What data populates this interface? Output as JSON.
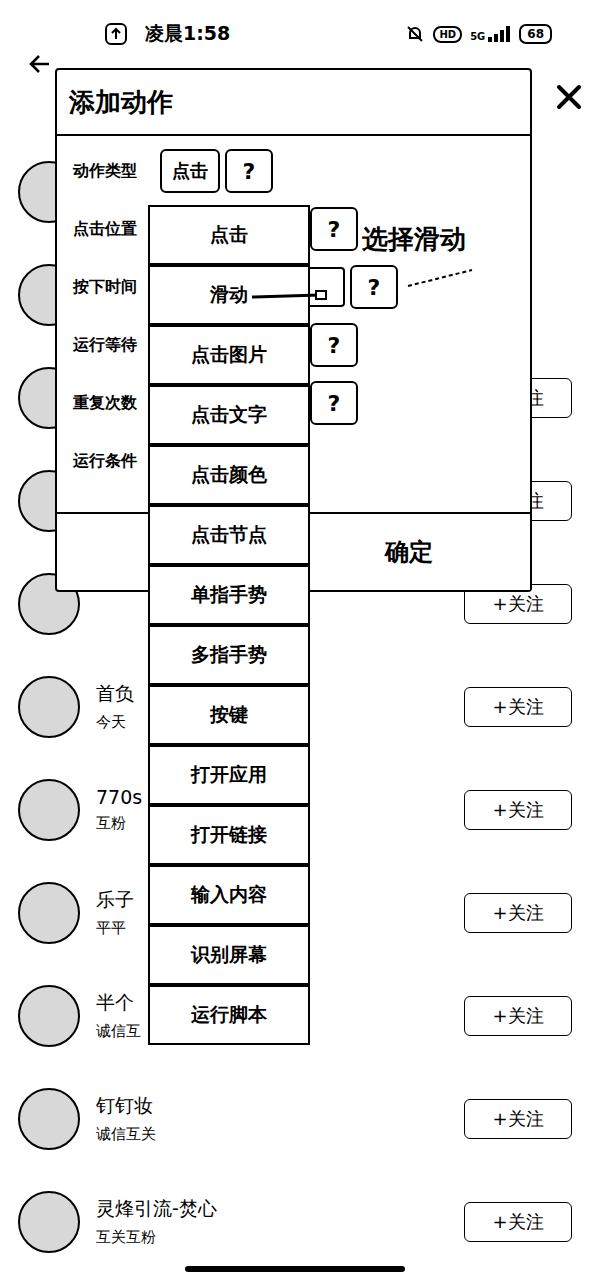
{
  "statusBar": {
    "time": "凌晨1:58",
    "hd": "HD",
    "network": "5G",
    "battery": "68"
  },
  "list": [
    {
      "name": "",
      "sub": "",
      "follow": ""
    },
    {
      "name": "",
      "sub": "",
      "follow": ""
    },
    {
      "name": "",
      "sub": "",
      "follow": "+关注"
    },
    {
      "name": "",
      "sub": "",
      "follow": "+关注"
    },
    {
      "name": "",
      "sub": "",
      "follow": "+关注"
    },
    {
      "name": "首负",
      "sub": "今天",
      "follow": "+关注"
    },
    {
      "name": "770s",
      "sub": "互粉",
      "follow": "+关注"
    },
    {
      "name": "乐子",
      "sub": "平平",
      "follow": "+关注"
    },
    {
      "name": "半个",
      "sub": "诚信互",
      "follow": "+关注"
    },
    {
      "name": "钉钉妆",
      "sub": "诚信互关",
      "follow": "+关注"
    },
    {
      "name": "灵烽引流-焚心",
      "sub": "互关互粉",
      "follow": "+关注"
    }
  ],
  "dialog": {
    "title": "添加动作",
    "fields": [
      {
        "label": "动作类型",
        "kind": "select",
        "value": "点击",
        "help": "?"
      },
      {
        "label": "点击位置",
        "kind": "help",
        "help": "?"
      },
      {
        "label": "按下时间",
        "kind": "input-help",
        "help": "?"
      },
      {
        "label": "运行等待",
        "kind": "help",
        "help": "?"
      },
      {
        "label": "重复次数",
        "kind": "help",
        "help": "?"
      },
      {
        "label": "运行条件",
        "kind": "plain"
      }
    ],
    "confirm": "确定"
  },
  "menu": {
    "items": [
      {
        "label": "点击",
        "selected": false
      },
      {
        "label": "滑动",
        "selected": false
      },
      {
        "label": "点击图片",
        "selected": false
      },
      {
        "label": "点击文字",
        "selected": false
      },
      {
        "label": "点击颜色",
        "selected": false
      },
      {
        "label": "点击节点",
        "selected": false
      },
      {
        "label": "单指手势",
        "selected": false
      },
      {
        "label": "多指手势",
        "selected": false
      },
      {
        "label": "按键",
        "selected": false
      },
      {
        "label": "打开应用",
        "selected": false
      },
      {
        "label": "打开链接",
        "selected": false
      },
      {
        "label": "输入内容",
        "selected": false
      },
      {
        "label": "识别屏幕",
        "selected": false
      },
      {
        "label": "运行脚本",
        "selected": false
      }
    ]
  },
  "annotation": {
    "text": "选择滑动"
  }
}
